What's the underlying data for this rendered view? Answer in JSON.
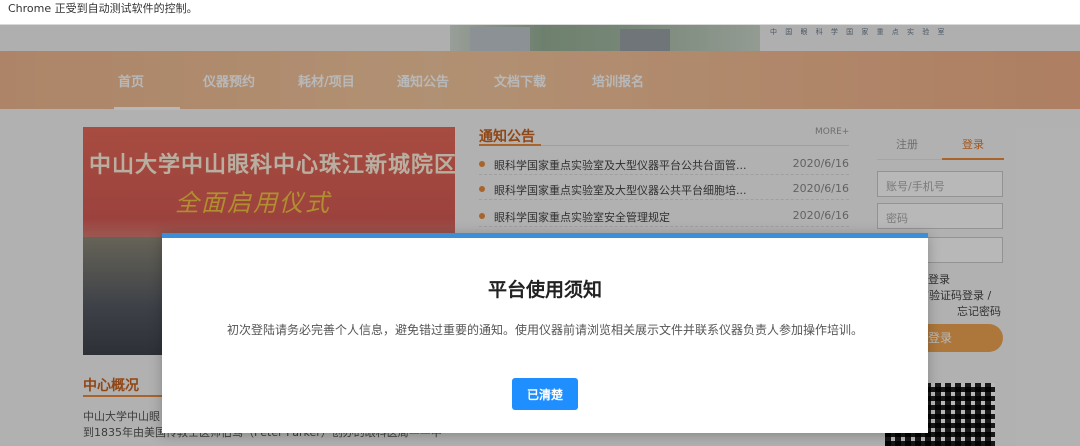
{
  "infobar": {
    "text": "Chrome 正受到自动测试软件的控制。"
  },
  "banner": {
    "lab_name": "中 国 眼 科 学 国 家 重 点 实 验 室"
  },
  "nav": {
    "items": [
      "首页",
      "仪器预约",
      "耗材/项目",
      "通知公告",
      "文档下载",
      "培训报名"
    ],
    "active": "首页"
  },
  "carousel": {
    "title": "中山大学中山眼科中心珠江新城院区",
    "subtitle": "全面启用仪式"
  },
  "overview": {
    "title": "中心概况",
    "lines": [
      "中山大学中山眼",
      "到1835年由美国传教士医师伯驾（Peter Parker）创办的眼科医局——中"
    ]
  },
  "notices": {
    "title": "通知公告",
    "more": "MORE+",
    "items": [
      {
        "text": "眼科学国家重点实验室及大型仪器平台公共台面管...",
        "date": "2020/6/16"
      },
      {
        "text": "眼科学国家重点实验室及大型仪器公共平台细胞培...",
        "date": "2020/6/16"
      },
      {
        "text": "眼科学国家重点实验室安全管理规定",
        "date": "2020/6/16"
      }
    ]
  },
  "login": {
    "tab_register": "注册",
    "tab_login": "登录",
    "account_placeholder": "账号/手机号",
    "password_placeholder": "密码",
    "remember": "登录",
    "sms_login": "信验证码登录 /",
    "forgot": "忘记密码",
    "submit": "登录"
  },
  "dialog": {
    "title": "平台使用须知",
    "message": "初次登陆请务必完善个人信息，避免错过重要的通知。使用仪器前请浏览相关展示文件并联系仪器负责人参加操作培训。",
    "confirm": "已清楚"
  },
  "colors": {
    "accent_orange": "#e98b3c",
    "nav_orange": "#f2b088",
    "dialog_border": "#3b8fd8",
    "button_blue": "#1f8fff"
  }
}
